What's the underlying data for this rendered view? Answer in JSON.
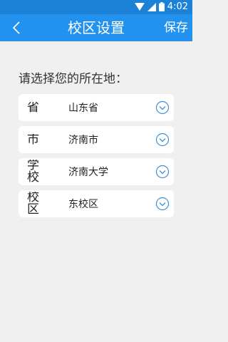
{
  "status_bar": {
    "time": "4:02",
    "icons": [
      "wifi-icon",
      "signal-icon",
      "battery-icon"
    ]
  },
  "app_bar": {
    "back_icon": "back-chevron-icon",
    "title": "校区设置",
    "save_label": "保存"
  },
  "prompt": "请选择您的所在地：",
  "fields": [
    {
      "label": "省",
      "value": "山东省"
    },
    {
      "label": "市",
      "value": "济南市"
    },
    {
      "label": "学校",
      "value": "济南大学"
    },
    {
      "label": "校区",
      "value": "东校区"
    }
  ],
  "colors": {
    "accent": "#2392ef",
    "status_bar": "#1b82d8",
    "background": "#f0f0f0"
  }
}
